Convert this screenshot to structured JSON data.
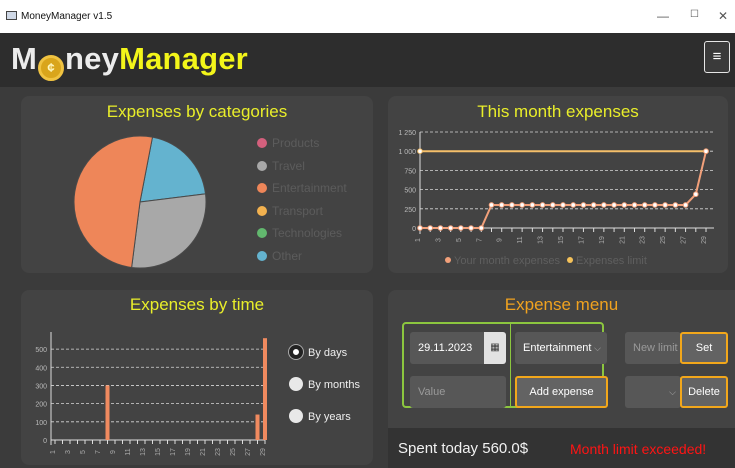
{
  "window": {
    "title": "MoneyManager v1.5",
    "min": "—",
    "max": "☐",
    "close": "✕"
  },
  "logo": {
    "m": "M",
    "coin": "¢",
    "rest": "ney",
    "brand": "Manager"
  },
  "menu_icon": "≡",
  "categories_panel": {
    "title": "Expenses by categories",
    "legend": [
      {
        "label": "Products",
        "color": "#d4607d"
      },
      {
        "label": "Travel",
        "color": "#a8a8a8"
      },
      {
        "label": "Entertainment",
        "color": "#ee8659"
      },
      {
        "label": "Transport",
        "color": "#f2b14f"
      },
      {
        "label": "Technologies",
        "color": "#62b86e"
      },
      {
        "label": "Other",
        "color": "#64b3cf"
      }
    ]
  },
  "month_panel": {
    "title": "This month expenses"
  },
  "time_panel": {
    "title": "Expenses by time",
    "radios": [
      {
        "label": "By days",
        "selected": true
      },
      {
        "label": "By months",
        "selected": false
      },
      {
        "label": "By years",
        "selected": false
      }
    ]
  },
  "menu_panel": {
    "title": "Expense menu",
    "date": "29.11.2023",
    "calendar_icon": "▦",
    "category": "Entertainment",
    "value_placeholder": "Value",
    "add_label": "Add expense",
    "limit_placeholder": "New limit",
    "set_label": "Set",
    "delete_label": "Delete",
    "spent": "Spent today 560.0$",
    "warning": "Month limit exceeded!",
    "chevron": "⌵"
  },
  "chart_data": [
    {
      "type": "pie",
      "title": "Expenses by categories",
      "slices": [
        {
          "name": "Products",
          "value": 0
        },
        {
          "name": "Travel",
          "value": 29
        },
        {
          "name": "Entertainment",
          "value": 51
        },
        {
          "name": "Transport",
          "value": 0
        },
        {
          "name": "Technologies",
          "value": 0
        },
        {
          "name": "Other",
          "value": 20
        }
      ]
    },
    {
      "type": "line",
      "title": "This month expenses",
      "ylim": [
        0,
        1250
      ],
      "yticks": [
        0,
        250,
        500,
        750,
        1000,
        1250
      ],
      "x": [
        1,
        2,
        3,
        4,
        5,
        6,
        7,
        8,
        9,
        10,
        11,
        12,
        13,
        14,
        15,
        16,
        17,
        18,
        19,
        20,
        21,
        22,
        23,
        24,
        25,
        26,
        27,
        28,
        29
      ],
      "xticklabels": [
        1,
        3,
        5,
        7,
        9,
        11,
        13,
        15,
        17,
        19,
        21,
        23,
        25,
        27,
        29
      ],
      "series": [
        {
          "name": "Your month expenses",
          "values": [
            0,
            0,
            0,
            0,
            0,
            0,
            0,
            300,
            300,
            300,
            300,
            300,
            300,
            300,
            300,
            300,
            300,
            300,
            300,
            300,
            300,
            300,
            300,
            300,
            300,
            300,
            300,
            440,
            1000
          ]
        },
        {
          "name": "Expenses limit",
          "values": [
            1000,
            1000,
            1000,
            1000,
            1000,
            1000,
            1000,
            1000,
            1000,
            1000,
            1000,
            1000,
            1000,
            1000,
            1000,
            1000,
            1000,
            1000,
            1000,
            1000,
            1000,
            1000,
            1000,
            1000,
            1000,
            1000,
            1000,
            1000,
            1000
          ]
        }
      ],
      "legend_position": "bottom"
    },
    {
      "type": "bar",
      "title": "Expenses by time",
      "ylim": [
        0,
        550
      ],
      "yticks": [
        0,
        100,
        200,
        300,
        400,
        500
      ],
      "categories": [
        1,
        2,
        3,
        4,
        5,
        6,
        7,
        8,
        9,
        10,
        11,
        12,
        13,
        14,
        15,
        16,
        17,
        18,
        19,
        20,
        21,
        22,
        23,
        24,
        25,
        26,
        27,
        28,
        29
      ],
      "xticklabels": [
        1,
        3,
        5,
        7,
        9,
        11,
        13,
        15,
        17,
        19,
        21,
        23,
        25,
        27,
        29
      ],
      "values": [
        0,
        0,
        0,
        0,
        0,
        0,
        0,
        300,
        0,
        0,
        0,
        0,
        0,
        0,
        0,
        0,
        0,
        0,
        0,
        0,
        0,
        0,
        0,
        0,
        0,
        0,
        0,
        140,
        560
      ]
    }
  ]
}
